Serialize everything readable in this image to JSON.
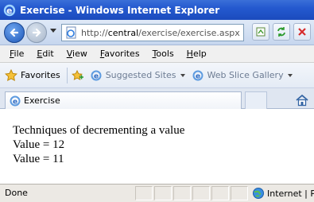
{
  "window": {
    "title": "Exercise - Windows Internet Explorer"
  },
  "address": {
    "prefix": "http://",
    "host": "central",
    "path": "/exercise/exercise.aspx"
  },
  "menu": [
    {
      "label": "ile",
      "key": "F"
    },
    {
      "label": "dit",
      "key": "E"
    },
    {
      "label": "iew",
      "key": "V"
    },
    {
      "label": "avorites",
      "key": "F",
      "pre": ""
    },
    {
      "label": "ools",
      "key": "T"
    },
    {
      "label": "elp",
      "key": "H"
    }
  ],
  "favorites": {
    "favorites_label": "Favorites",
    "suggested_label": "Suggested Sites",
    "webslice_label": "Web Slice Gallery"
  },
  "tab": {
    "label": "Exercise"
  },
  "content": {
    "line1": "Techniques of decrementing a value",
    "line2": "Value = 12",
    "line3": "Value = 11"
  },
  "status": {
    "text": "Done",
    "zone": "Internet | Pr"
  },
  "colors": {
    "titlebar": "#2459cf",
    "accent": "#1d57b8"
  },
  "icons": {
    "ie_logo": "ie-logo-icon",
    "back": "back-arrow-icon",
    "forward": "forward-arrow-icon",
    "page": "page-icon",
    "compat": "compatibility-view-icon",
    "refresh": "refresh-icon",
    "stop": "stop-icon",
    "star": "favorites-star-icon",
    "add_fav": "add-favorites-icon",
    "home": "home-icon",
    "globe": "globe-icon"
  }
}
